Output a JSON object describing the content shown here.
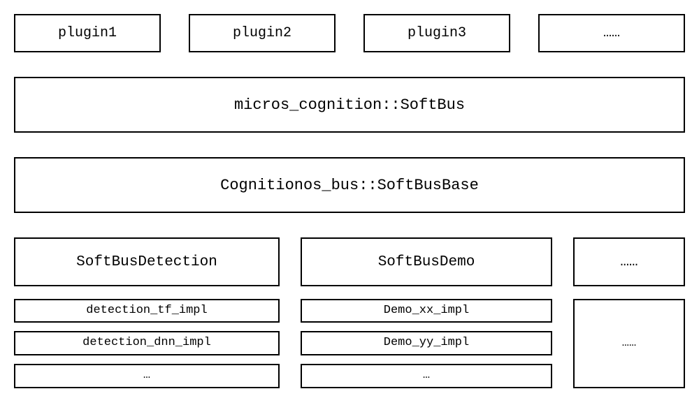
{
  "plugins": {
    "items": [
      "plugin1",
      "plugin2",
      "plugin3",
      "……"
    ]
  },
  "layers": {
    "softbus": "micros_cognition::SoftBus",
    "softbusbase": "Cognitionos_bus::SoftBusBase"
  },
  "groups": {
    "detection": {
      "title": "SoftBusDetection",
      "impls": [
        "detection_tf_impl",
        "detection_dnn_impl",
        "…"
      ]
    },
    "demo": {
      "title": "SoftBusDemo",
      "impls": [
        "Demo_xx_impl",
        "Demo_yy_impl",
        "…"
      ]
    },
    "more": {
      "title": "……",
      "impls": [
        "……"
      ]
    }
  }
}
